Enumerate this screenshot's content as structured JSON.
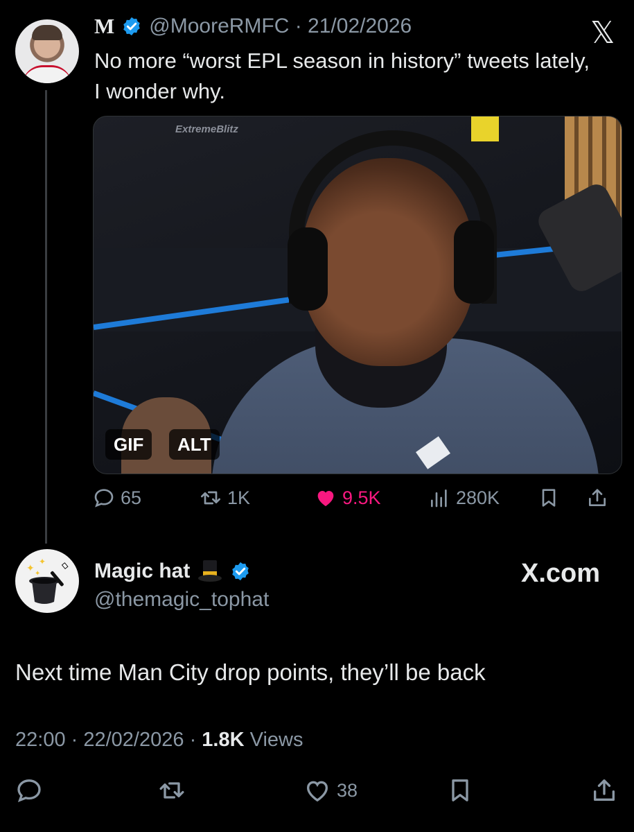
{
  "quoted": {
    "author_name": "M",
    "handle_date": "@MooreRMFC · 21/02/2026",
    "text": "No more “worst EPL season in history” tweets lately, I wonder why.",
    "media": {
      "watermark": "ExtremeBlitz",
      "badge_gif": "GIF",
      "badge_alt": "ALT"
    },
    "actions": {
      "replies": "65",
      "reposts": "1K",
      "likes": "9.5K",
      "views": "280K"
    }
  },
  "reply": {
    "author_name": "Magic hat",
    "handle": "@themagic_tophat",
    "text": "Next time Man City drop points, they’ll be back",
    "time": "22:00",
    "date": "22/02/2026",
    "views_count": "1.8K",
    "views_label": "Views",
    "likes": "38"
  },
  "brand": {
    "site": "X.com",
    "logo": "𝕏"
  },
  "colors": {
    "background": "#000000",
    "verified": "#1d9bf0",
    "like": "#f91880",
    "muted": "#8b98a5"
  }
}
